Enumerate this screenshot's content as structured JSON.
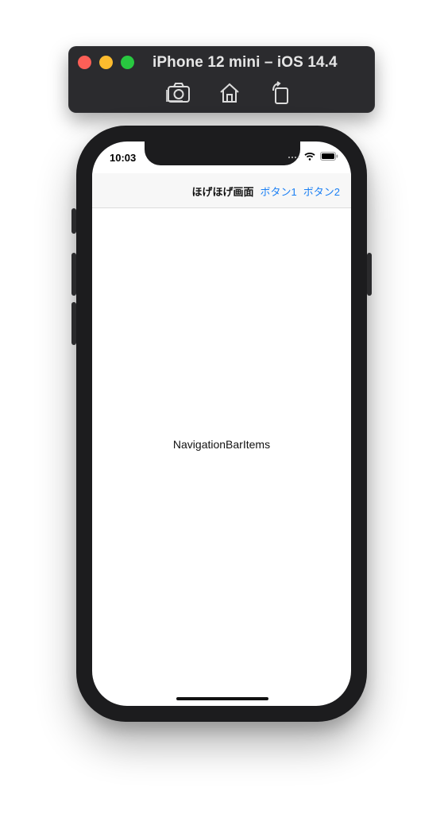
{
  "simulator": {
    "title": "iPhone 12 mini – iOS 14.4",
    "toolbar": {
      "screenshot_icon": "camera-screenshot-icon",
      "home_icon": "home-icon",
      "rotate_icon": "rotate-icon"
    }
  },
  "status_bar": {
    "time": "10:03"
  },
  "navigation_bar": {
    "title": "ほげほげ画面",
    "button1": "ボタン1",
    "button2": "ボタン2"
  },
  "content": {
    "label": "NavigationBarItems"
  },
  "colors": {
    "accent": "#1a7ff4",
    "close": "#fe5f57",
    "minimize": "#febc2e",
    "zoom": "#28c840"
  }
}
